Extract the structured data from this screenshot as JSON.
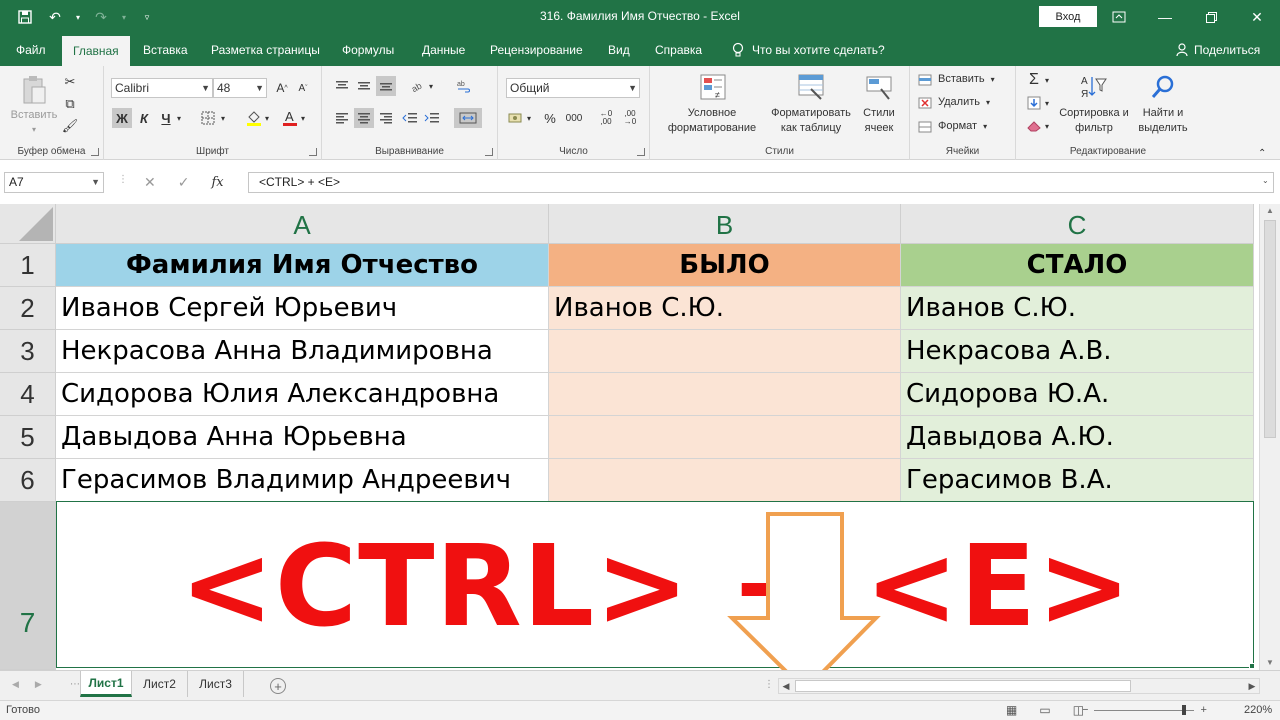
{
  "title": "316. Фамилия Имя Отчество  -  Excel",
  "signin_label": "Вход",
  "tabs": [
    "Файл",
    "Главная",
    "Вставка",
    "Разметка страницы",
    "Формулы",
    "Данные",
    "Рецензирование",
    "Вид",
    "Справка"
  ],
  "tell_me": "Что вы хотите сделать?",
  "share_label": "Поделиться",
  "ribbon": {
    "clipboard": {
      "paste": "Вставить",
      "label": "Буфер обмена"
    },
    "font": {
      "name": "Calibri",
      "size": "48",
      "bold": "Ж",
      "italic": "К",
      "underline": "Ч",
      "label": "Шрифт"
    },
    "alignment": {
      "label": "Выравнивание"
    },
    "number": {
      "format": "Общий",
      "percent": "%",
      "thousands": "000",
      "label": "Число"
    },
    "styles": {
      "conditional": "Условное форматирование",
      "as_table": "Форматировать как таблицу",
      "cell_styles": "Стили ячеек",
      "label": "Стили"
    },
    "cells": {
      "insert": "Вставить",
      "delete": "Удалить",
      "format": "Формат",
      "label": "Ячейки"
    },
    "editing": {
      "sort": "Сортировка и фильтр",
      "find": "Найти и выделить",
      "label": "Редактирование"
    }
  },
  "namebox": "A7",
  "formula": "<CTRL> + <E>",
  "columns": [
    "A",
    "B",
    "C"
  ],
  "rows": [
    {
      "num": "1",
      "A": "Фамилия Имя Отчество",
      "B": "БЫЛО",
      "C": "СТАЛО"
    },
    {
      "num": "2",
      "A": "Иванов Сергей Юрьевич",
      "B": "Иванов С.Ю.",
      "C": "Иванов С.Ю."
    },
    {
      "num": "3",
      "A": "Некрасова Анна Владимировна",
      "B": "",
      "C": "Некрасова А.В."
    },
    {
      "num": "4",
      "A": "Сидорова Юлия Александровна",
      "B": "",
      "C": "Сидорова Ю.А."
    },
    {
      "num": "5",
      "A": "Давыдова Анна Юрьевна",
      "B": "",
      "C": "Давыдова А.Ю."
    },
    {
      "num": "6",
      "A": "Герасимов Владимир Андреевич",
      "B": "",
      "C": "Герасимов В.А."
    }
  ],
  "row7": {
    "num": "7",
    "text": "<CTRL> + <E>"
  },
  "sheets": [
    "Лист1",
    "Лист2",
    "Лист3"
  ],
  "status": "Готово",
  "zoom": "220%",
  "colors": {
    "excel_green": "#217346",
    "header_blue": "#9dd3e8",
    "header_orange": "#f4b183",
    "header_green": "#a9d08e",
    "shortcut_red": "#f01010",
    "arrow_orange": "#f0a050"
  }
}
